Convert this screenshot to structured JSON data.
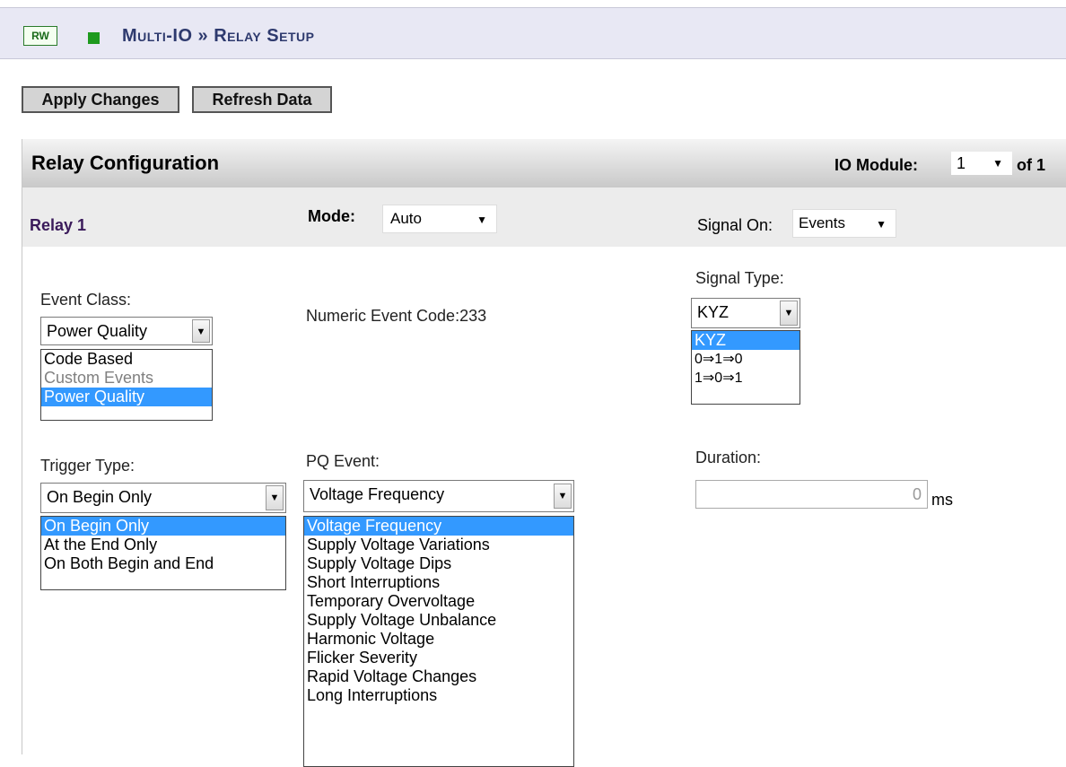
{
  "header": {
    "badge": "RW",
    "title": "Multi-IO » Relay Setup"
  },
  "toolbar": {
    "apply_label": "Apply Changes",
    "refresh_label": "Refresh Data"
  },
  "panel": {
    "title": "Relay Configuration",
    "io_module_label": "IO Module:",
    "io_module_value": "1",
    "io_module_total": "of 1"
  },
  "relay": {
    "name": "Relay 1",
    "mode_label": "Mode:",
    "mode_value": "Auto",
    "signal_on_label": "Signal On:",
    "signal_on_value": "Events"
  },
  "event_class": {
    "label": "Event Class:",
    "value": "Power Quality",
    "options": [
      "Code Based",
      "Custom Events",
      "Power Quality"
    ]
  },
  "numeric_event_code": "Numeric Event Code:233",
  "signal_type": {
    "label": "Signal Type:",
    "value": "KYZ",
    "options": [
      "KYZ",
      "0⇒1⇒0",
      "1⇒0⇒1"
    ]
  },
  "trigger_type": {
    "label": "Trigger Type:",
    "value": "On Begin Only",
    "options": [
      "On Begin Only",
      "At the End Only",
      "On Both Begin and End"
    ]
  },
  "pq_event": {
    "label": "PQ Event:",
    "value": "Voltage Frequency",
    "options": [
      "Voltage Frequency",
      "Supply Voltage Variations",
      "Supply Voltage Dips",
      "Short Interruptions",
      "Temporary Overvoltage",
      "Supply Voltage Unbalance",
      "Harmonic Voltage",
      "Flicker Severity",
      "Rapid Voltage Changes",
      "Long Interruptions"
    ]
  },
  "duration": {
    "label": "Duration:",
    "value": "0",
    "unit": "ms"
  },
  "colors": {
    "title": "#2e3a6e",
    "highlight": "#3399ff",
    "badge_green": "#1e9a1e",
    "relay_name": "#3a1a5a"
  },
  "icons": {
    "status": "green-square-icon",
    "dropdown": "chevron-down-icon"
  }
}
